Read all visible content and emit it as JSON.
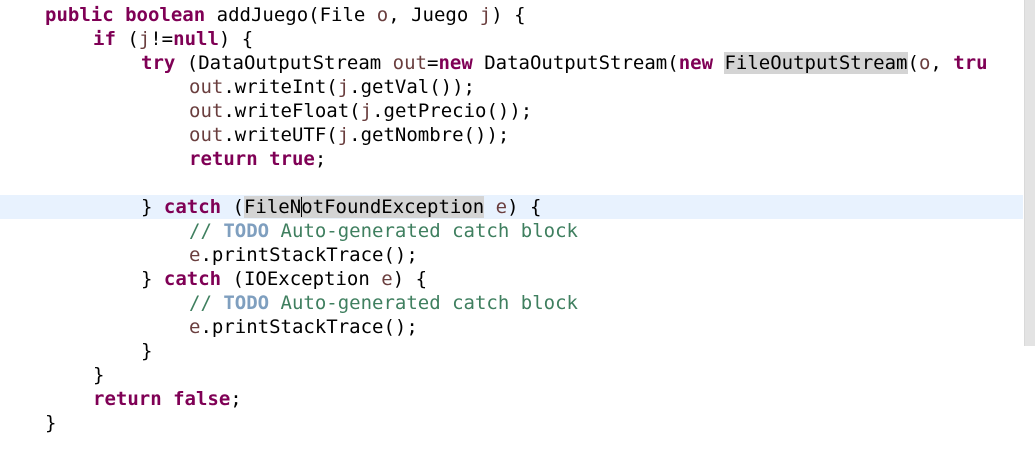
{
  "editor": {
    "language": "java",
    "colors": {
      "keyword": "#7f0055",
      "comment": "#3f7f5f",
      "todo": "#7f9fbf",
      "local_variable": "#6a3e3e",
      "current_line": "#e8f2fe",
      "occurrence_highlight": "#d4d4d4"
    },
    "lines": {
      "l1": {
        "kw1": "public",
        "kw2": "boolean",
        "t1": "addJuego(File ",
        "v1": "o",
        "t2": ", Juego ",
        "v2": "j",
        "t3": ") {"
      },
      "l2": {
        "kw1": "if",
        "t1": " (",
        "v1": "j",
        "t2": "!=",
        "kw2": "null",
        "t3": ") {"
      },
      "l3": {
        "kw1": "try",
        "t1": " (DataOutputStream ",
        "v1": "out",
        "t2": "=",
        "kw2": "new",
        "t3": " DataOutputStream(",
        "kw3": "new",
        "t4": " ",
        "occ": "FileOutputStream",
        "t5": "(",
        "v2": "o",
        "t6": ", ",
        "kw4": "tru"
      },
      "l4": {
        "v1": "out",
        "t1": ".writeInt(",
        "v2": "j",
        "t2": ".getVal());"
      },
      "l5": {
        "v1": "out",
        "t1": ".writeFloat(",
        "v2": "j",
        "t2": ".getPrecio());"
      },
      "l6": {
        "v1": "out",
        "t1": ".writeUTF(",
        "v2": "j",
        "t2": ".getNombre());"
      },
      "l7": {
        "kw1": "return",
        "kw2": "true",
        "t1": ";"
      },
      "l9": {
        "t1": "} ",
        "kw1": "catch",
        "t2": " (",
        "occ_a": "FileN",
        "occ_b": "otFoundException",
        "t3": " ",
        "v1": "e",
        "t4": ") {"
      },
      "l10": {
        "c1": "// ",
        "todo": "TODO",
        "c2": " Auto-generated catch block"
      },
      "l11": {
        "v1": "e",
        "t1": ".printStackTrace();"
      },
      "l12": {
        "t1": "} ",
        "kw1": "catch",
        "t2": " (IOException ",
        "v1": "e",
        "t3": ") {"
      },
      "l13": {
        "c1": "// ",
        "todo": "TODO",
        "c2": " Auto-generated catch block"
      },
      "l14": {
        "v1": "e",
        "t1": ".printStackTrace();"
      },
      "l15": {
        "t1": "}"
      },
      "l16": {
        "t1": "}"
      },
      "l17": {
        "kw1": "return",
        "kw2": "false",
        "t1": ";"
      },
      "l18": {
        "t1": "}"
      }
    }
  }
}
